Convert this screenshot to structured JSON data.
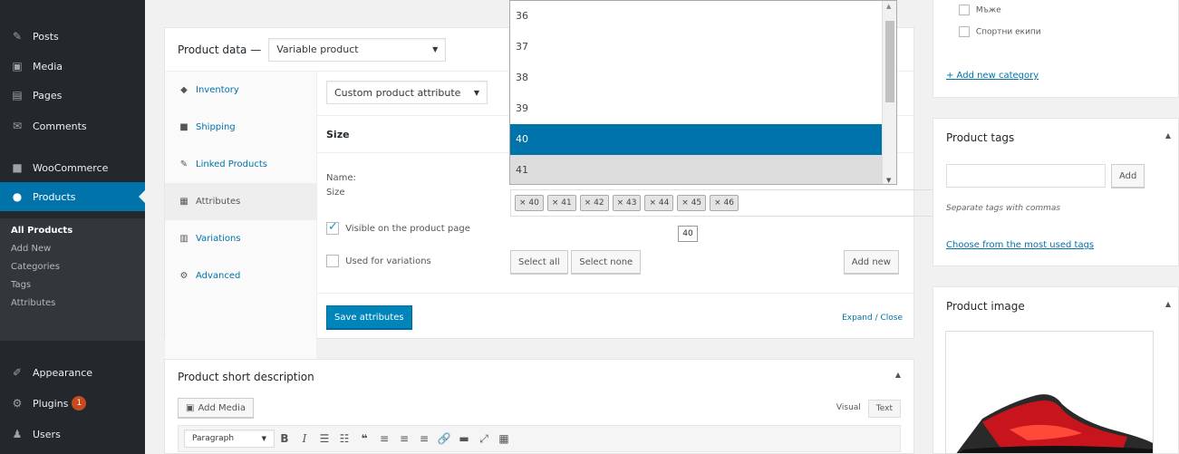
{
  "sidebar": {
    "menu": [
      {
        "label": "Posts",
        "icon": "pin-icon"
      },
      {
        "label": "Media",
        "icon": "media-icon"
      },
      {
        "label": "Pages",
        "icon": "pages-icon"
      },
      {
        "label": "Comments",
        "icon": "comments-icon"
      },
      {
        "label": "WooCommerce",
        "icon": "woocommerce-icon"
      },
      {
        "label": "Products",
        "icon": "products-icon"
      }
    ],
    "submenu": [
      "All Products",
      "Add New",
      "Categories",
      "Tags",
      "Attributes"
    ],
    "menu_bottom": [
      {
        "label": "Appearance",
        "icon": "brush-icon"
      },
      {
        "label": "Plugins",
        "icon": "plugin-icon",
        "badge": "1"
      },
      {
        "label": "Users",
        "icon": "users-icon"
      }
    ]
  },
  "product_data": {
    "title": "Product data —",
    "type_select": "Variable product",
    "tabs": [
      {
        "label": "Inventory",
        "icon": "inventory-icon"
      },
      {
        "label": "Shipping",
        "icon": "truck-icon"
      },
      {
        "label": "Linked Products",
        "icon": "link-icon"
      },
      {
        "label": "Attributes",
        "icon": "table-icon"
      },
      {
        "label": "Variations",
        "icon": "grid-icon"
      },
      {
        "label": "Advanced",
        "icon": "gear-icon"
      }
    ],
    "attr_select": "Custom product attribute",
    "attr_name_header": "Size",
    "name_label": "Name:",
    "name_value": "Size",
    "visible_label": "Visible on the product page",
    "variations_label": "Used for variations",
    "chips": [
      "× 40",
      "× 41",
      "× 42",
      "× 43",
      "× 44",
      "× 45",
      "× 46"
    ],
    "typed_value": "40",
    "select_all": "Select all",
    "select_none": "Select none",
    "add_new": "Add new",
    "save_attributes": "Save attributes",
    "expand_close": "Expand / Close"
  },
  "dropdown": {
    "options": [
      "36",
      "37",
      "38",
      "39",
      "40",
      "41"
    ],
    "selected": "40",
    "hover": "41"
  },
  "short_description": {
    "title": "Product short description",
    "add_media": "Add Media",
    "visual_tab": "Visual",
    "text_tab": "Text",
    "paragraph": "Paragraph"
  },
  "categories": {
    "items": [
      "Мъже",
      "Спортни екипи"
    ],
    "add_link": "+ Add new category"
  },
  "tags": {
    "title": "Product tags",
    "add_button": "Add",
    "hint": "Separate tags with commas",
    "choose_link": "Choose from the most used tags"
  },
  "image": {
    "title": "Product image"
  }
}
